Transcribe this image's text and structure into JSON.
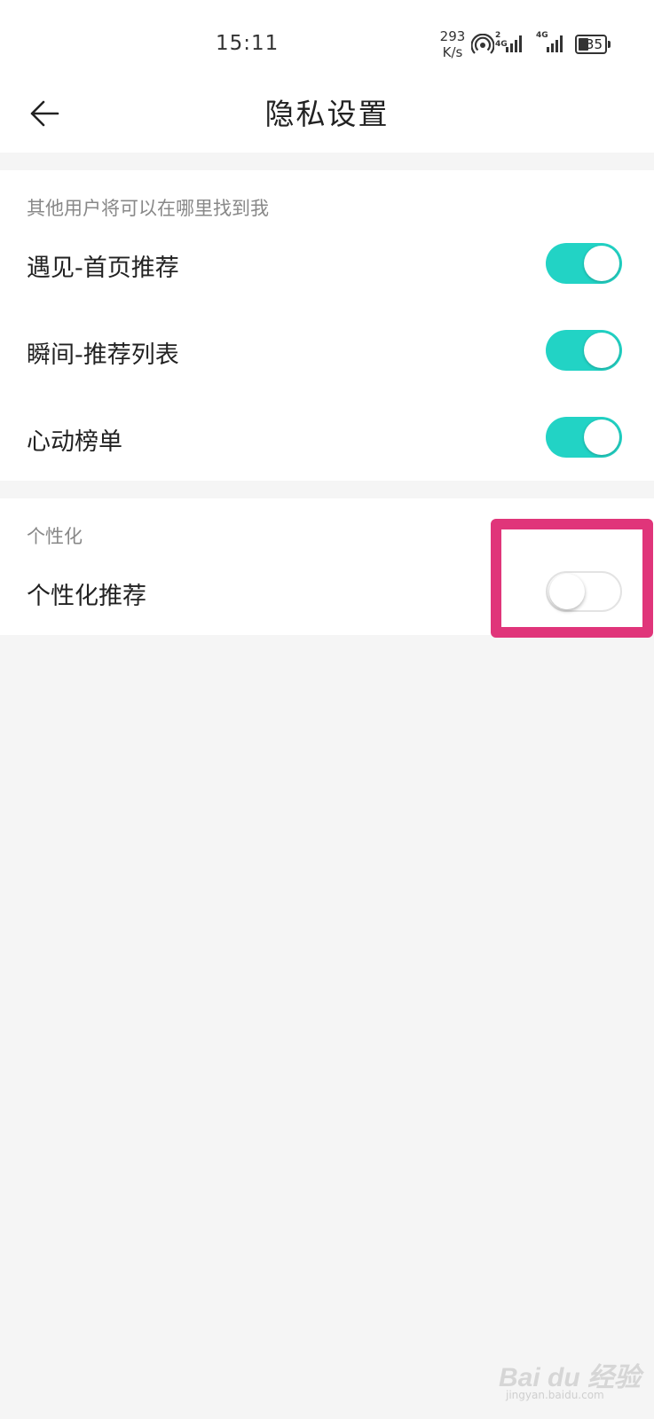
{
  "status_bar": {
    "time": "15:11",
    "net_speed_value": "293",
    "net_speed_unit": "K/s",
    "sim1_tag": "2 4G",
    "sim2_tag": "4G",
    "battery": "35",
    "battery_level": 0.35,
    "icons": [
      "hotspot-icon",
      "signal-icon",
      "battery-icon"
    ]
  },
  "header": {
    "back_icon": "arrow-left-icon",
    "title": "隐私设置"
  },
  "sections": [
    {
      "title": "其他用户将可以在哪里找到我",
      "items": [
        {
          "label": "遇见-首页推荐",
          "enabled": true
        },
        {
          "label": "瞬间-推荐列表",
          "enabled": true
        },
        {
          "label": "心动榜单",
          "enabled": true
        }
      ]
    },
    {
      "title": "个性化",
      "items": [
        {
          "label": "个性化推荐",
          "enabled": false
        }
      ]
    }
  ],
  "colors": {
    "toggle_on": "#22d3c5",
    "highlight": "#e0357a",
    "background": "#f5f5f5"
  },
  "watermark": {
    "brand": "Bai du 经验",
    "site": "jingyan.baidu.com"
  }
}
